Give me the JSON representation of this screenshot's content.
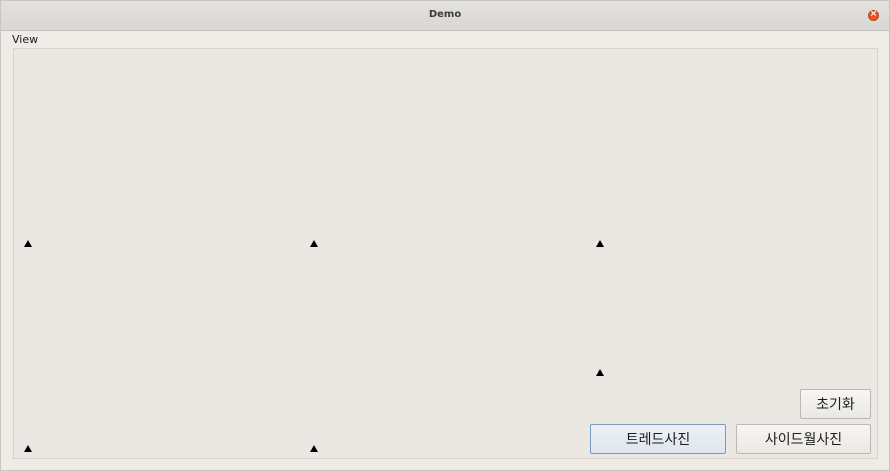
{
  "window": {
    "title": "Demo"
  },
  "view": {
    "label": "View",
    "markers": [
      "marker-1",
      "marker-2",
      "marker-3",
      "marker-4",
      "marker-5",
      "marker-6"
    ]
  },
  "buttons": {
    "reset": "초기화",
    "trend_photo": "트레드사진",
    "sidewall_photo": "사이드월사진"
  }
}
